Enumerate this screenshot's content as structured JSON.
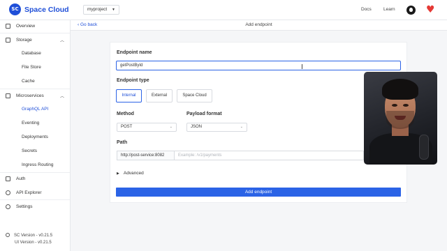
{
  "header": {
    "brand": "Space Cloud",
    "logo_text": "SC",
    "project": "myproject",
    "links": [
      "Docs",
      "Learn"
    ],
    "icons": [
      "github-icon",
      "heart-icon"
    ]
  },
  "sidebar": {
    "items": [
      {
        "label": "Overview",
        "icon": "home-icon"
      },
      {
        "label": "Storage",
        "icon": "database-icon",
        "expanded": true,
        "children": [
          "Database",
          "File Store",
          "Cache"
        ]
      },
      {
        "label": "Microservices",
        "icon": "grid-icon",
        "expanded": true,
        "children": [
          "GraphQL API",
          "Eventing",
          "Deployments",
          "Secrets",
          "Ingress Routing"
        ]
      },
      {
        "label": "Auth",
        "icon": "key-icon"
      },
      {
        "label": "API Explorer",
        "icon": "compass-icon"
      },
      {
        "label": "Settings",
        "icon": "gear-icon"
      }
    ],
    "active_child": "GraphQL API",
    "versions": [
      "SC Version - v0.21.5",
      "UI Version - v0.21.5"
    ]
  },
  "subheader": {
    "back_label": "Go back",
    "title": "Add endpoint"
  },
  "form": {
    "endpoint_name_label": "Endpoint name",
    "endpoint_name_value": "getPostById",
    "endpoint_type_label": "Endpoint type",
    "endpoint_types": [
      "Internal",
      "External",
      "Space Cloud"
    ],
    "endpoint_type_selected": "Internal",
    "method_label": "Method",
    "method_value": "POST",
    "payload_label": "Payload format",
    "payload_value": "JSON",
    "path_label": "Path",
    "path_prefix": "http://post-service:8082",
    "path_placeholder": "Example: /v1/payments",
    "advanced_label": "Advanced",
    "submit_label": "Add endpoint"
  },
  "colors": {
    "accent": "#2b63e6",
    "brand": "#1f4fd8",
    "heart": "#e53935"
  }
}
